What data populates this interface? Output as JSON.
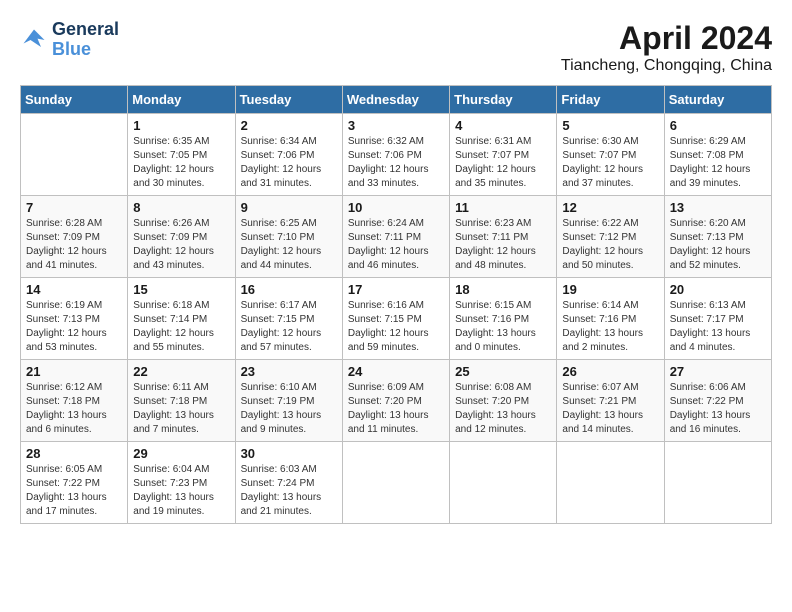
{
  "header": {
    "logo_line1": "General",
    "logo_line2": "Blue",
    "month": "April 2024",
    "location": "Tiancheng, Chongqing, China"
  },
  "weekdays": [
    "Sunday",
    "Monday",
    "Tuesday",
    "Wednesday",
    "Thursday",
    "Friday",
    "Saturday"
  ],
  "weeks": [
    [
      {
        "date": "",
        "sunrise": "",
        "sunset": "",
        "daylight": ""
      },
      {
        "date": "1",
        "sunrise": "Sunrise: 6:35 AM",
        "sunset": "Sunset: 7:05 PM",
        "daylight": "Daylight: 12 hours and 30 minutes."
      },
      {
        "date": "2",
        "sunrise": "Sunrise: 6:34 AM",
        "sunset": "Sunset: 7:06 PM",
        "daylight": "Daylight: 12 hours and 31 minutes."
      },
      {
        "date": "3",
        "sunrise": "Sunrise: 6:32 AM",
        "sunset": "Sunset: 7:06 PM",
        "daylight": "Daylight: 12 hours and 33 minutes."
      },
      {
        "date": "4",
        "sunrise": "Sunrise: 6:31 AM",
        "sunset": "Sunset: 7:07 PM",
        "daylight": "Daylight: 12 hours and 35 minutes."
      },
      {
        "date": "5",
        "sunrise": "Sunrise: 6:30 AM",
        "sunset": "Sunset: 7:07 PM",
        "daylight": "Daylight: 12 hours and 37 minutes."
      },
      {
        "date": "6",
        "sunrise": "Sunrise: 6:29 AM",
        "sunset": "Sunset: 7:08 PM",
        "daylight": "Daylight: 12 hours and 39 minutes."
      }
    ],
    [
      {
        "date": "7",
        "sunrise": "Sunrise: 6:28 AM",
        "sunset": "Sunset: 7:09 PM",
        "daylight": "Daylight: 12 hours and 41 minutes."
      },
      {
        "date": "8",
        "sunrise": "Sunrise: 6:26 AM",
        "sunset": "Sunset: 7:09 PM",
        "daylight": "Daylight: 12 hours and 43 minutes."
      },
      {
        "date": "9",
        "sunrise": "Sunrise: 6:25 AM",
        "sunset": "Sunset: 7:10 PM",
        "daylight": "Daylight: 12 hours and 44 minutes."
      },
      {
        "date": "10",
        "sunrise": "Sunrise: 6:24 AM",
        "sunset": "Sunset: 7:11 PM",
        "daylight": "Daylight: 12 hours and 46 minutes."
      },
      {
        "date": "11",
        "sunrise": "Sunrise: 6:23 AM",
        "sunset": "Sunset: 7:11 PM",
        "daylight": "Daylight: 12 hours and 48 minutes."
      },
      {
        "date": "12",
        "sunrise": "Sunrise: 6:22 AM",
        "sunset": "Sunset: 7:12 PM",
        "daylight": "Daylight: 12 hours and 50 minutes."
      },
      {
        "date": "13",
        "sunrise": "Sunrise: 6:20 AM",
        "sunset": "Sunset: 7:13 PM",
        "daylight": "Daylight: 12 hours and 52 minutes."
      }
    ],
    [
      {
        "date": "14",
        "sunrise": "Sunrise: 6:19 AM",
        "sunset": "Sunset: 7:13 PM",
        "daylight": "Daylight: 12 hours and 53 minutes."
      },
      {
        "date": "15",
        "sunrise": "Sunrise: 6:18 AM",
        "sunset": "Sunset: 7:14 PM",
        "daylight": "Daylight: 12 hours and 55 minutes."
      },
      {
        "date": "16",
        "sunrise": "Sunrise: 6:17 AM",
        "sunset": "Sunset: 7:15 PM",
        "daylight": "Daylight: 12 hours and 57 minutes."
      },
      {
        "date": "17",
        "sunrise": "Sunrise: 6:16 AM",
        "sunset": "Sunset: 7:15 PM",
        "daylight": "Daylight: 12 hours and 59 minutes."
      },
      {
        "date": "18",
        "sunrise": "Sunrise: 6:15 AM",
        "sunset": "Sunset: 7:16 PM",
        "daylight": "Daylight: 13 hours and 0 minutes."
      },
      {
        "date": "19",
        "sunrise": "Sunrise: 6:14 AM",
        "sunset": "Sunset: 7:16 PM",
        "daylight": "Daylight: 13 hours and 2 minutes."
      },
      {
        "date": "20",
        "sunrise": "Sunrise: 6:13 AM",
        "sunset": "Sunset: 7:17 PM",
        "daylight": "Daylight: 13 hours and 4 minutes."
      }
    ],
    [
      {
        "date": "21",
        "sunrise": "Sunrise: 6:12 AM",
        "sunset": "Sunset: 7:18 PM",
        "daylight": "Daylight: 13 hours and 6 minutes."
      },
      {
        "date": "22",
        "sunrise": "Sunrise: 6:11 AM",
        "sunset": "Sunset: 7:18 PM",
        "daylight": "Daylight: 13 hours and 7 minutes."
      },
      {
        "date": "23",
        "sunrise": "Sunrise: 6:10 AM",
        "sunset": "Sunset: 7:19 PM",
        "daylight": "Daylight: 13 hours and 9 minutes."
      },
      {
        "date": "24",
        "sunrise": "Sunrise: 6:09 AM",
        "sunset": "Sunset: 7:20 PM",
        "daylight": "Daylight: 13 hours and 11 minutes."
      },
      {
        "date": "25",
        "sunrise": "Sunrise: 6:08 AM",
        "sunset": "Sunset: 7:20 PM",
        "daylight": "Daylight: 13 hours and 12 minutes."
      },
      {
        "date": "26",
        "sunrise": "Sunrise: 6:07 AM",
        "sunset": "Sunset: 7:21 PM",
        "daylight": "Daylight: 13 hours and 14 minutes."
      },
      {
        "date": "27",
        "sunrise": "Sunrise: 6:06 AM",
        "sunset": "Sunset: 7:22 PM",
        "daylight": "Daylight: 13 hours and 16 minutes."
      }
    ],
    [
      {
        "date": "28",
        "sunrise": "Sunrise: 6:05 AM",
        "sunset": "Sunset: 7:22 PM",
        "daylight": "Daylight: 13 hours and 17 minutes."
      },
      {
        "date": "29",
        "sunrise": "Sunrise: 6:04 AM",
        "sunset": "Sunset: 7:23 PM",
        "daylight": "Daylight: 13 hours and 19 minutes."
      },
      {
        "date": "30",
        "sunrise": "Sunrise: 6:03 AM",
        "sunset": "Sunset: 7:24 PM",
        "daylight": "Daylight: 13 hours and 21 minutes."
      },
      {
        "date": "",
        "sunrise": "",
        "sunset": "",
        "daylight": ""
      },
      {
        "date": "",
        "sunrise": "",
        "sunset": "",
        "daylight": ""
      },
      {
        "date": "",
        "sunrise": "",
        "sunset": "",
        "daylight": ""
      },
      {
        "date": "",
        "sunrise": "",
        "sunset": "",
        "daylight": ""
      }
    ]
  ]
}
